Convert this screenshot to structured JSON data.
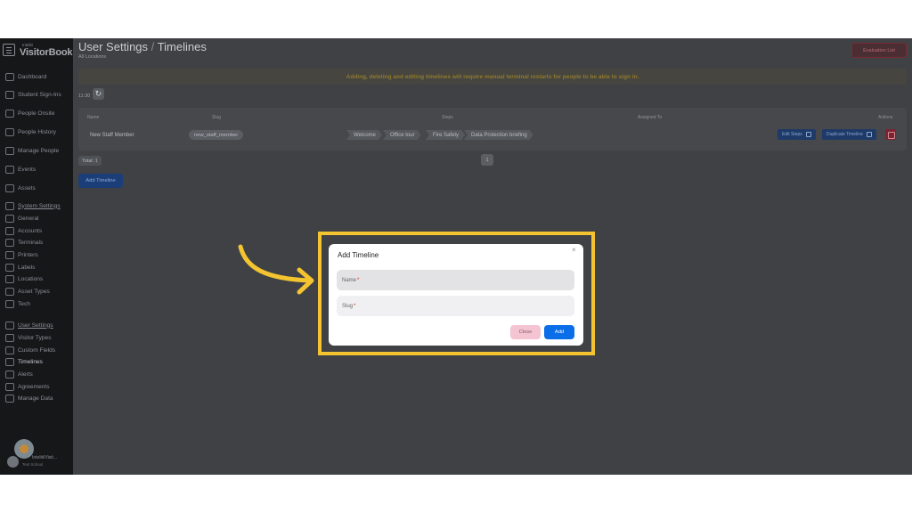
{
  "brand": {
    "small": "Inteliti",
    "big": "VisitorBook"
  },
  "sidebar": {
    "items": [
      {
        "label": "Dashboard",
        "icon": "dashboard-icon"
      },
      {
        "label": "Student Sign-Ins",
        "icon": "student-icon"
      },
      {
        "label": "People Onsite",
        "icon": "people-icon"
      },
      {
        "label": "People History",
        "icon": "history-icon"
      },
      {
        "label": "Manage People",
        "icon": "manage-people-icon"
      },
      {
        "label": "Events",
        "icon": "calendar-icon"
      },
      {
        "label": "Assets",
        "icon": "assets-icon"
      },
      {
        "label": "System Settings",
        "icon": "settings-icon"
      },
      {
        "label": "General",
        "icon": "gear-icon"
      },
      {
        "label": "Accounts",
        "icon": "accounts-icon"
      },
      {
        "label": "Terminals",
        "icon": "terminal-icon"
      },
      {
        "label": "Printers",
        "icon": "printer-icon"
      },
      {
        "label": "Labels",
        "icon": "label-icon"
      },
      {
        "label": "Locations",
        "icon": "location-pin-icon"
      },
      {
        "label": "Asset Types",
        "icon": "asset-types-icon"
      },
      {
        "label": "Tech",
        "icon": "tech-icon"
      },
      {
        "label": "User Settings",
        "icon": "user-settings-icon"
      },
      {
        "label": "Visitor Types",
        "icon": "visitor-types-icon"
      },
      {
        "label": "Custom Fields",
        "icon": "custom-fields-icon"
      },
      {
        "label": "Timelines",
        "icon": "timeline-icon"
      },
      {
        "label": "Alerts",
        "icon": "alert-icon"
      },
      {
        "label": "Agreements",
        "icon": "agreement-icon"
      },
      {
        "label": "Manage Data",
        "icon": "database-icon"
      }
    ],
    "user": {
      "name": "Inteliti/Visit...",
      "org": "Test School"
    }
  },
  "header": {
    "section": "User Settings",
    "separator": "/",
    "title": "Timelines",
    "subtitle": "All Locations",
    "evaluation_label": "Evaluation List"
  },
  "warning": "Adding, deleting and editing timelines will require manual terminal restarts for people to be able to sign in.",
  "date_label": "11:30",
  "refresh_icon": "↻",
  "table": {
    "headers": {
      "name": "Name",
      "slug": "Slug",
      "steps": "Steps",
      "assigned_to": "Assigned To",
      "actions": "Actions"
    },
    "row": {
      "name": "New Staff Member",
      "slug": "new_staff_member",
      "steps": [
        "Welcome",
        "Office tour",
        "Fire Safety",
        "Data Protection briefing"
      ],
      "edit_label": "Edit Steps",
      "duplicate_label": "Duplicate Timeline"
    }
  },
  "total_label": "Total: 1",
  "page_number": "1",
  "add_timeline_label": "Add Timeline",
  "modal": {
    "title": "Add Timeline",
    "close_icon": "×",
    "name_placeholder": "Name",
    "slug_placeholder": "Slug",
    "required_mark": "*",
    "close_label": "Close",
    "add_label": "Add"
  },
  "colors": {
    "highlight": "#f4c430",
    "arrow": "#f4c430",
    "primary": "#0a6ee8",
    "close_button": "#f5c4d3"
  }
}
